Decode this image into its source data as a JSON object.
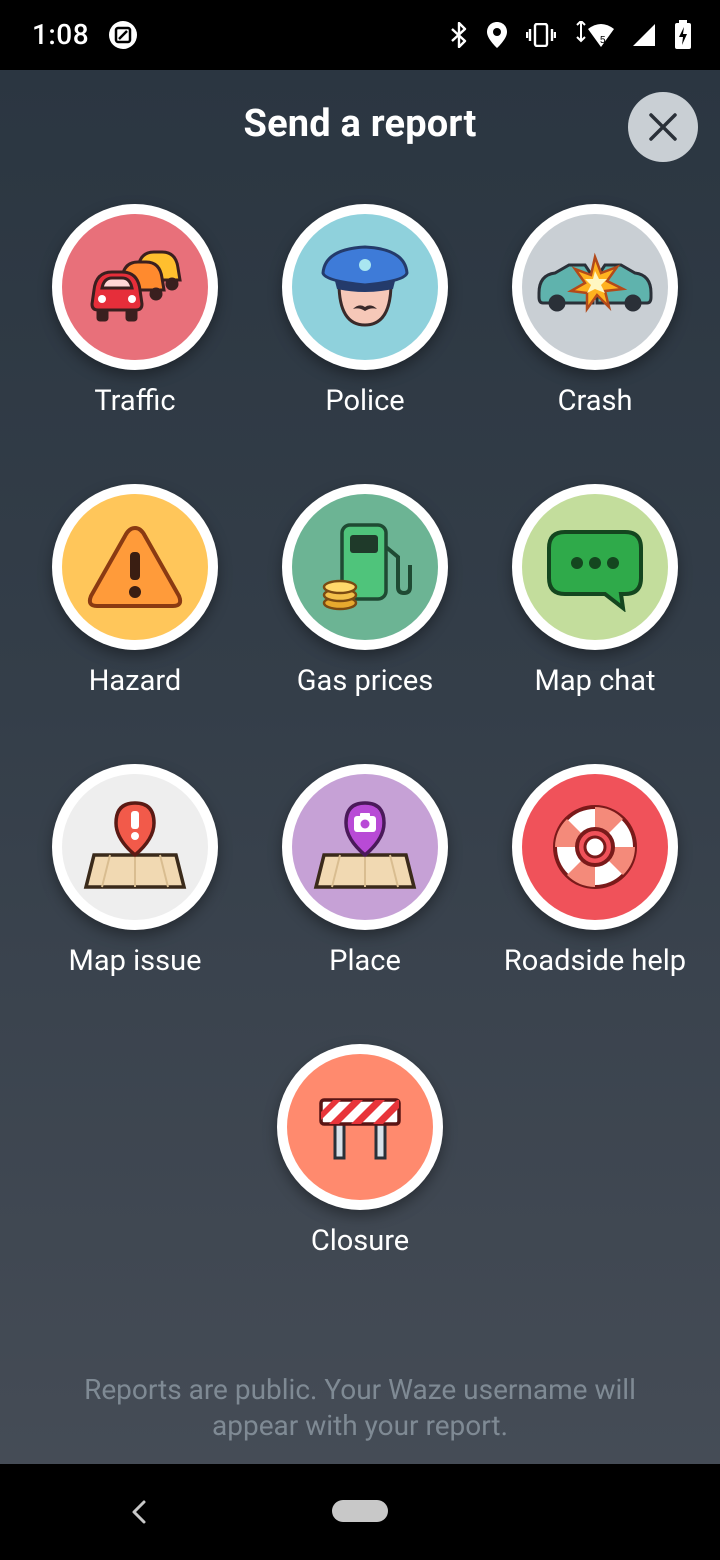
{
  "status_bar": {
    "time": "1:08",
    "left_icon": "screenshot-icon",
    "icons": [
      "bluetooth-icon",
      "location-icon",
      "vibrate-icon",
      "wifi-icon",
      "signal-icon",
      "battery-charging-icon"
    ]
  },
  "dialog": {
    "title": "Send a report",
    "close_icon": "close-icon",
    "items": [
      {
        "label": "Traffic",
        "icon": "traffic-icon",
        "bg": "#e8707a"
      },
      {
        "label": "Police",
        "icon": "police-icon",
        "bg": "#8fd1dc"
      },
      {
        "label": "Crash",
        "icon": "crash-icon",
        "bg": "#c9cfd4"
      },
      {
        "label": "Hazard",
        "icon": "hazard-icon",
        "bg": "#ffc65a"
      },
      {
        "label": "Gas prices",
        "icon": "gas-prices-icon",
        "bg": "#6cb494"
      },
      {
        "label": "Map chat",
        "icon": "map-chat-icon",
        "bg": "#c3dd9c"
      },
      {
        "label": "Map issue",
        "icon": "map-issue-icon",
        "bg": "#eeeeee"
      },
      {
        "label": "Place",
        "icon": "place-icon",
        "bg": "#c6a1d6"
      },
      {
        "label": "Roadside help",
        "icon": "roadside-help-icon",
        "bg": "#f0525a"
      },
      {
        "label": "Closure",
        "icon": "closure-icon",
        "bg": "#ff8a6e"
      }
    ],
    "footer": "Reports are public. Your Waze username will appear with your report."
  },
  "nav_bar": {
    "back_icon": "back-icon",
    "home_icon": "home-pill-icon"
  }
}
